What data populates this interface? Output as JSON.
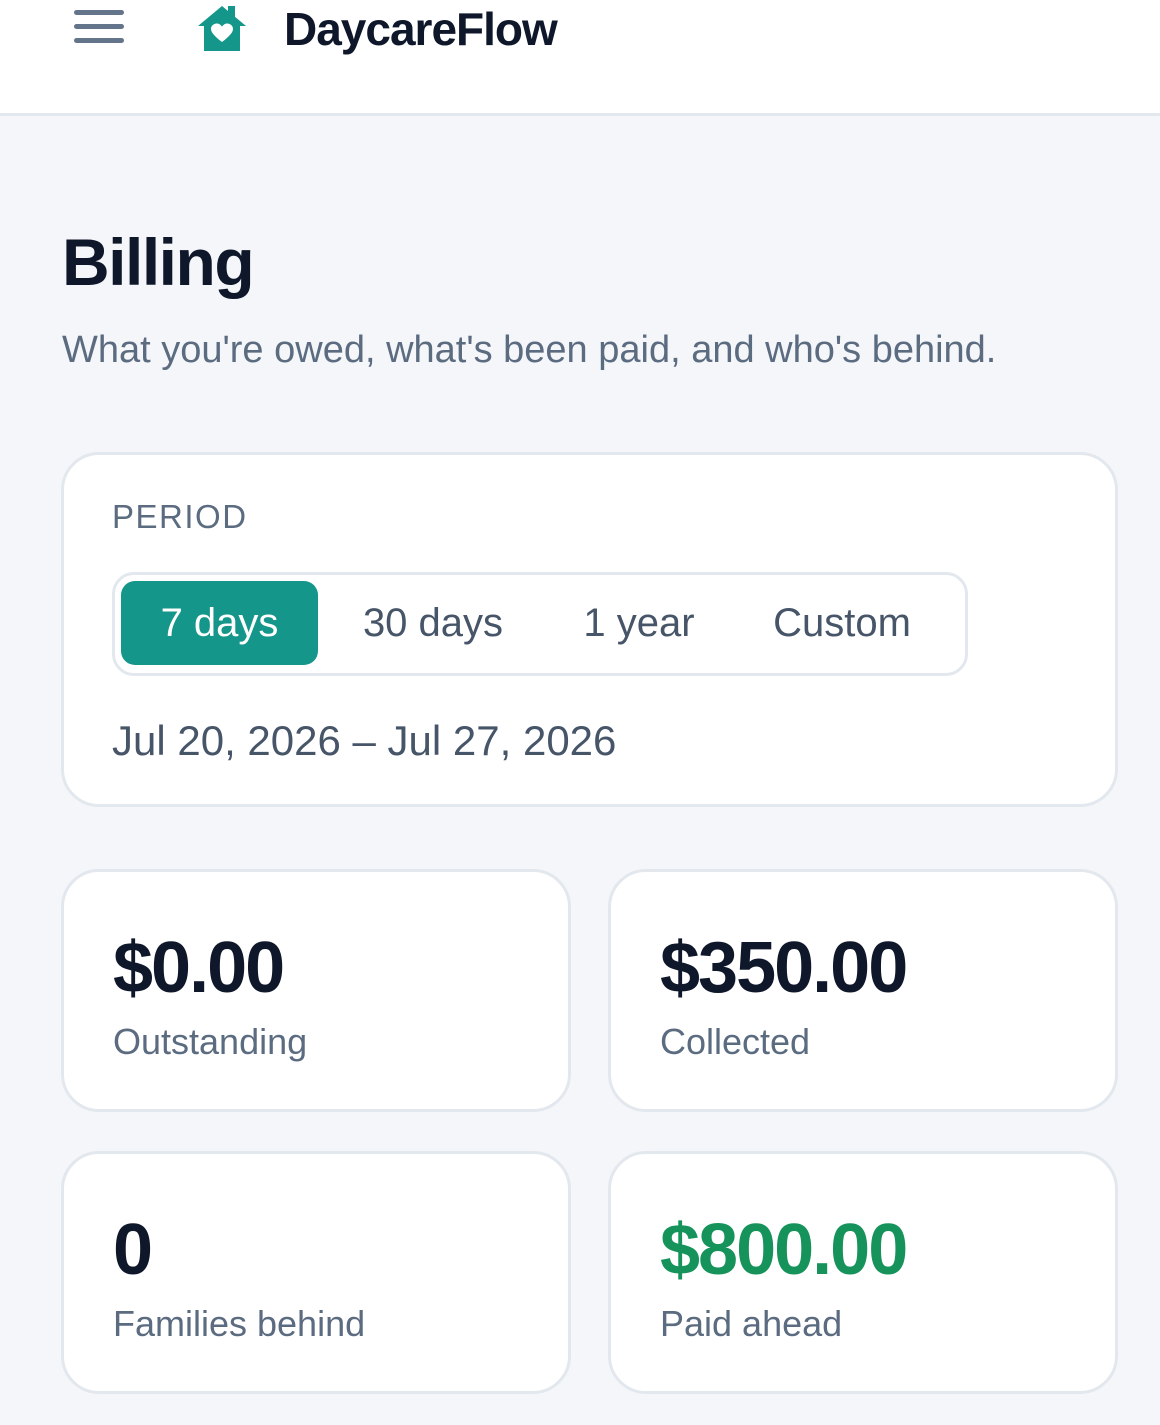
{
  "header": {
    "menu_icon": "hamburger-menu-icon",
    "logo_icon": "house-heart-icon",
    "brand": "DaycareFlow"
  },
  "page": {
    "title": "Billing",
    "subtitle": "What you're owed, what's been paid, and who's behind."
  },
  "period": {
    "label": "PERIOD",
    "options": [
      "7 days",
      "30 days",
      "1 year",
      "Custom"
    ],
    "selected": "7 days",
    "range": "Jul 20, 2026 – Jul 27, 2026"
  },
  "stats": [
    {
      "value": "$0.00",
      "label": "Outstanding"
    },
    {
      "value": "$350.00",
      "label": "Collected"
    },
    {
      "value": "0",
      "label": "Families behind"
    },
    {
      "value": "$800.00",
      "label": "Paid ahead"
    }
  ],
  "colors": {
    "accent": "#15968a",
    "positive": "#16935a",
    "text": "#0f172a",
    "muted": "#5b6b80",
    "background": "#f4f6f9"
  }
}
